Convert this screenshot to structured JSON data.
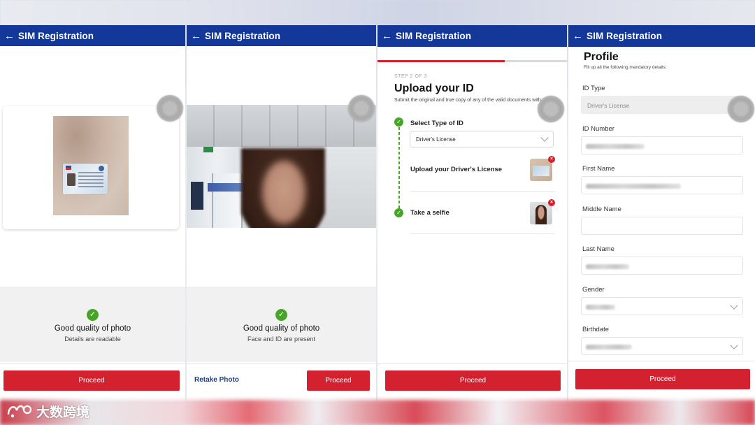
{
  "app_title": "SIM Registration",
  "screen1": {
    "quality_title": "Good quality of photo",
    "quality_sub": "Details are readable",
    "proceed_label": "Proceed"
  },
  "screen2": {
    "quality_title": "Good quality of photo",
    "quality_sub": "Face and ID are present",
    "retake_label": "Retake Photo",
    "proceed_label": "Proceed"
  },
  "screen3": {
    "progress": 0.67,
    "step_label": "STEP 2 OF 3",
    "title": "Upload your ID",
    "description": "Submit the original and true copy of any of the valid documents with photo",
    "select_type_label": "Select Type of ID",
    "id_type_value": "Driver's License",
    "upload_label": "Upload your Driver's License",
    "selfie_label": "Take a selfie",
    "proceed_label": "Proceed"
  },
  "screen4": {
    "title": "Profile",
    "subtitle": "Fill up all the following mandatory details:",
    "fields": {
      "id_type": {
        "label": "ID Type",
        "value": "Driver's License"
      },
      "id_number": {
        "label": "ID Number"
      },
      "first_name": {
        "label": "First Name"
      },
      "middle_name": {
        "label": "Middle Name"
      },
      "last_name": {
        "label": "Last Name"
      },
      "gender": {
        "label": "Gender"
      },
      "birthdate": {
        "label": "Birthdate"
      }
    },
    "proceed_label": "Proceed"
  },
  "watermark": "大数跨境",
  "colors": {
    "appbar": "#14379a",
    "primary_button": "#d3212f",
    "success": "#45a529",
    "link": "#1d3d8f"
  }
}
